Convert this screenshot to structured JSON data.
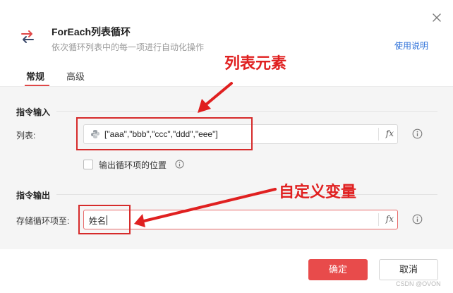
{
  "dialog": {
    "title": "ForEach列表循环",
    "subtitle": "依次循环列表中的每一项进行自动化操作",
    "help_link": "使用说明"
  },
  "tabs": [
    {
      "label": "常规",
      "active": true
    },
    {
      "label": "高级",
      "active": false
    }
  ],
  "input_section": {
    "title": "指令输入",
    "list_field": {
      "label": "列表:",
      "value": "[\"aaa\",\"bbb\",\"ccc\",\"ddd\",\"eee\"]",
      "fx": "fx"
    },
    "checkbox": {
      "label": "输出循环项的位置",
      "checked": false
    }
  },
  "output_section": {
    "title": "指令输出",
    "store_field": {
      "label": "存储循环项至:",
      "value": "姓名",
      "fx": "fx"
    }
  },
  "annotations": {
    "list_elements": "列表元素",
    "custom_variable": "自定义变量"
  },
  "footer": {
    "confirm_label": "确定",
    "cancel_label": "取消"
  },
  "watermark": "CSDN @OVON",
  "colors": {
    "accent": "#e84b4b",
    "annotation_red": "#e02020",
    "link_blue": "#2b6fd8"
  },
  "icons": [
    "close-icon",
    "loop-icon",
    "python-icon",
    "info-icon",
    "fx-icon"
  ]
}
